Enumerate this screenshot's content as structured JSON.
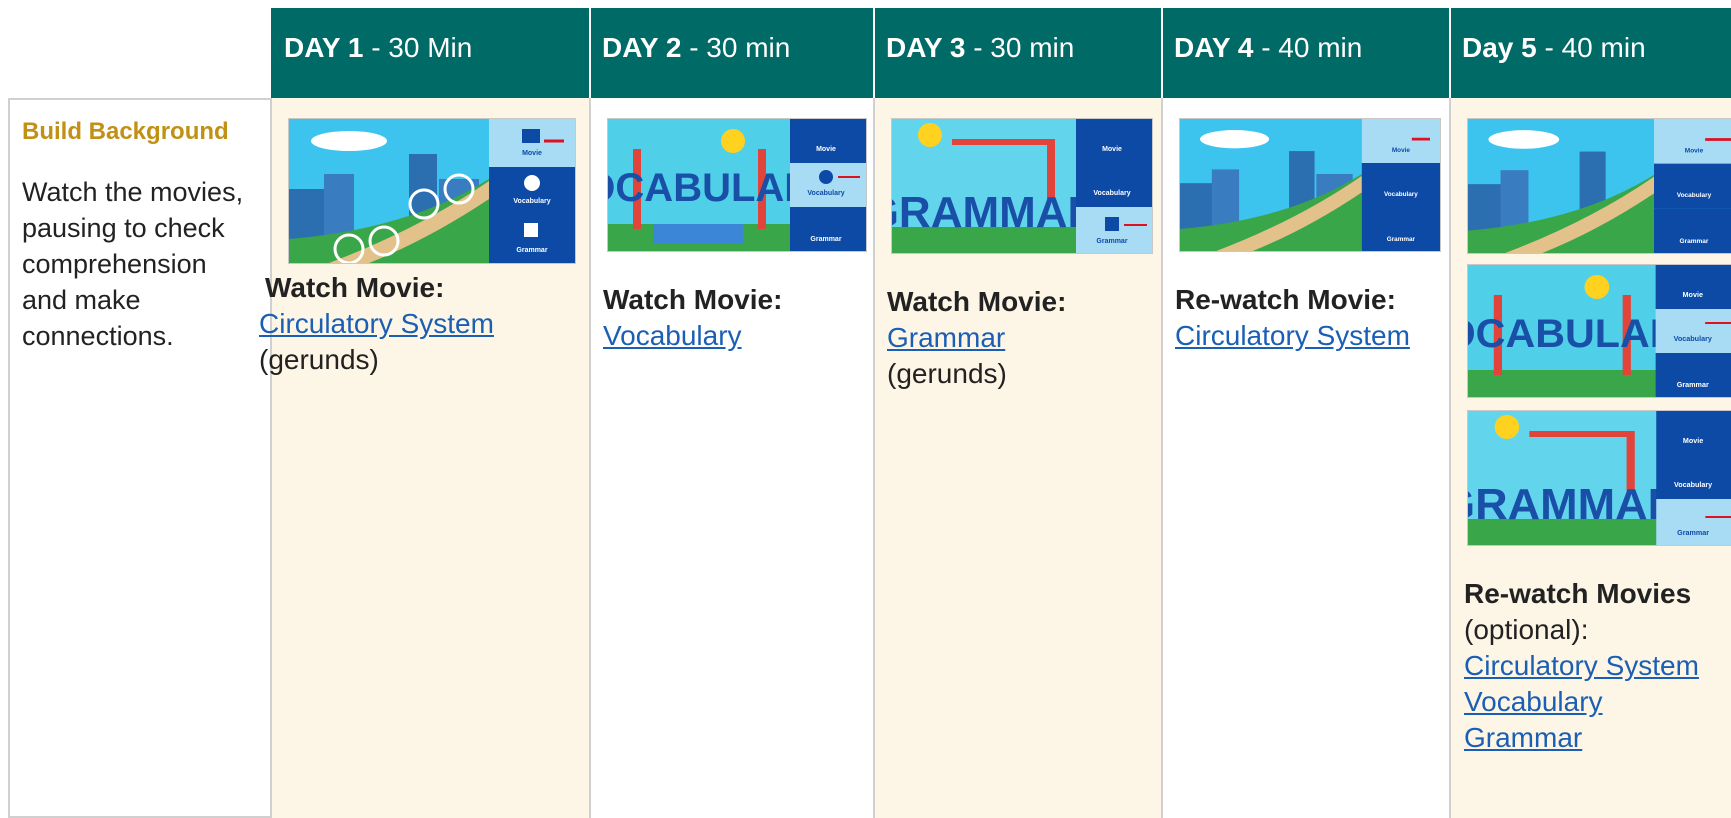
{
  "label": {
    "title": "Build Background",
    "body": "Watch the movies, pausing to check comprehension and make connections."
  },
  "days": [
    {
      "day": "DAY 1",
      "duration": "- 30 Min"
    },
    {
      "day": "DAY 2",
      "duration": "- 30 min"
    },
    {
      "day": "DAY 3",
      "duration": "- 30 min"
    },
    {
      "day": "DAY 4",
      "duration": "- 40 min"
    },
    {
      "day": "Day 5",
      "duration": "- 40 min"
    }
  ],
  "menu": {
    "movie": "Movie",
    "vocabulary": "Vocabulary",
    "grammar": "Grammar"
  },
  "thumbs": {
    "vocab_word": "VOCABULARY",
    "grammar_word": "GRAMMAR"
  },
  "cells": {
    "d1": {
      "heading": "Watch Movie:",
      "link": "Circulatory System",
      "note": "(gerunds)"
    },
    "d2": {
      "heading": "Watch Movie:",
      "link": "Vocabulary"
    },
    "d3": {
      "heading": "Watch Movie:",
      "link": "Grammar",
      "note": "(gerunds)"
    },
    "d4": {
      "heading": "Re-watch Movie:",
      "link": "Circulatory System"
    },
    "d5": {
      "heading": "Re-watch Movies",
      "note": "(optional):",
      "links": [
        "Circulatory System",
        "Vocabulary",
        "Grammar"
      ]
    }
  },
  "colors": {
    "header": "#006a66",
    "label_title": "#c09114",
    "link": "#1a5fb4",
    "cell_tint": "#fdf6e6"
  }
}
